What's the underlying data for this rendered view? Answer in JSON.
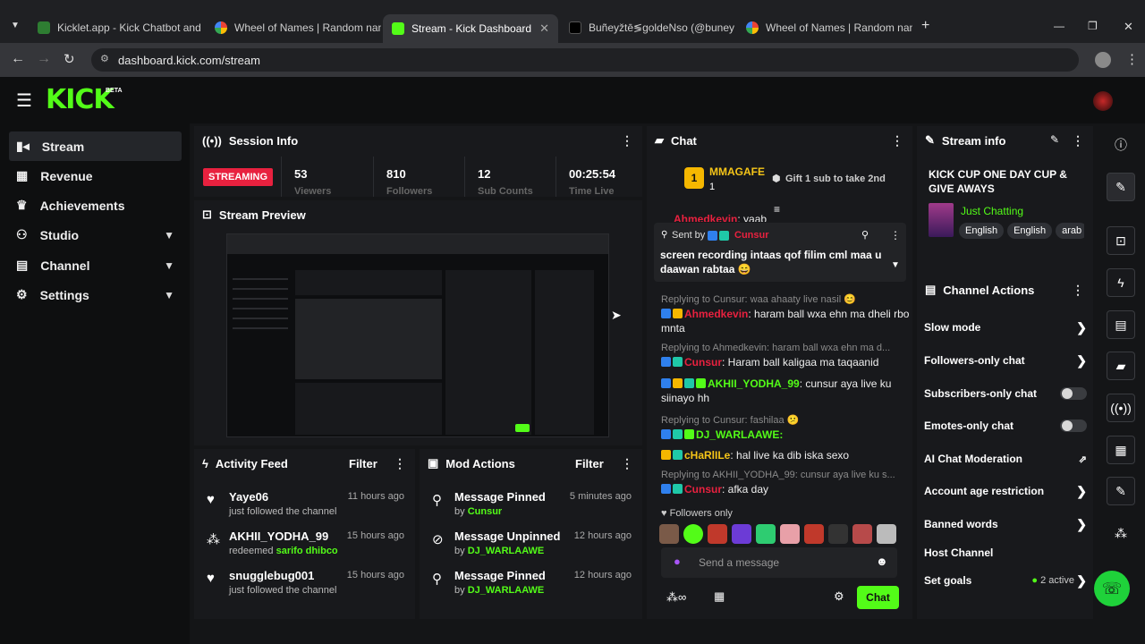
{
  "browser": {
    "tabs": [
      {
        "title": "Kicklet.app - Kick Chatbot and",
        "color": "#2e7d32"
      },
      {
        "title": "Wheel of Names | Random nan",
        "color": "#4285f4"
      },
      {
        "title": "Stream - Kick Dashboard",
        "color": "#53fc18"
      },
      {
        "title": "Buñeyžtē≶goldeNso (@buney",
        "color": "#000000"
      },
      {
        "title": "Wheel of Names | Random nan",
        "color": "#4285f4"
      }
    ],
    "url": "dashboard.kick.com/stream",
    "new_tab_icon": "+",
    "window_controls": [
      "—",
      "❐",
      "✕"
    ]
  },
  "app": {
    "logo": "KICK",
    "logo_badge": "BETA",
    "accent": "#53fc18"
  },
  "sidebar": {
    "items": [
      {
        "label": "Stream",
        "icon": "video-icon",
        "active": true
      },
      {
        "label": "Revenue",
        "icon": "chart-icon"
      },
      {
        "label": "Achievements",
        "icon": "trophy-icon"
      },
      {
        "label": "Studio",
        "icon": "studio-icon",
        "chevron": true
      },
      {
        "label": "Channel",
        "icon": "channel-icon",
        "chevron": true
      },
      {
        "label": "Settings",
        "icon": "gear-icon",
        "chevron": true
      }
    ]
  },
  "session": {
    "title": "Session Info",
    "status": "STREAMING",
    "stats": [
      {
        "value": "53",
        "label": "Viewers"
      },
      {
        "value": "810",
        "label": "Followers"
      },
      {
        "value": "12",
        "label": "Sub Counts"
      },
      {
        "value": "00:25:54",
        "label": "Time Live"
      }
    ]
  },
  "preview": {
    "title": "Stream Preview"
  },
  "activity": {
    "title": "Activity Feed",
    "filter": "Filter",
    "items": [
      {
        "name": "Yaye06",
        "sub": "just followed the channel",
        "time": "11 hours ago",
        "icon": "heart-icon"
      },
      {
        "name": "AKHII_YODHA_99",
        "sub_prefix": "redeemed ",
        "sub_highlight": "sarifo dhibco",
        "time": "15 hours ago",
        "icon": "points-icon"
      },
      {
        "name": "snugglebug001",
        "sub": "just followed the channel",
        "time": "15 hours ago",
        "icon": "heart-icon"
      }
    ]
  },
  "mod": {
    "title": "Mod Actions",
    "filter": "Filter",
    "items": [
      {
        "name": "Message Pinned",
        "by": "by ",
        "user": "Cunsur",
        "time": "5 minutes ago",
        "icon": "pin-icon"
      },
      {
        "name": "Message Unpinned",
        "by": "by ",
        "user": "DJ_WARLAAWE",
        "time": "12 hours ago",
        "icon": "unpin-icon"
      },
      {
        "name": "Message Pinned",
        "by": "by ",
        "user": "DJ_WARLAAWE",
        "time": "12 hours ago",
        "icon": "pin-icon"
      }
    ]
  },
  "chat": {
    "title": "Chat",
    "top_gifter": "MMAGAFE",
    "top_gifter_rank": "1",
    "top_gifter_count": "1",
    "gift_prompt": "Gift 1 sub to take 2nd",
    "pinned_by_label": "Sent by",
    "pinned_by": "Cunsur",
    "pinned_text": "screen recording intaas qof filim cml maa u daawan rabtaa 😄",
    "cut_user": "Ahmedkevin",
    "cut_text": ": yaab",
    "messages": [
      {
        "reply": "Replying to Cunsur: waa ahaaty live nasil 😊",
        "user": "Ahmedkevin",
        "user_class": "u-red",
        "text": ": haram ball wxa ehn ma dheli rbo mnta"
      },
      {
        "reply": "Replying to Ahmedkevin: haram ball wxa ehn ma d...",
        "user": "Cunsur",
        "user_class": "u-red",
        "text": ": Haram ball kaligaa ma taqaanid"
      },
      {
        "reply": "",
        "user": "AKHII_YODHA_99",
        "user_class": "u-green",
        "text": ": cunsur aya live ku siinayo hh"
      },
      {
        "reply": "Replying to Cunsur: fashilaa 😕",
        "user": "DJ_WARLAAWE:",
        "user_class": "u-green",
        "text": ""
      },
      {
        "reply": "",
        "user": "cHaRlILe",
        "user_class": "u-yel",
        "text": ": hal live ka dib iska sexo"
      },
      {
        "reply": "Replying to AKHII_YODHA_99: cunsur aya live ku s...",
        "user": "Cunsur",
        "user_class": "u-red",
        "text": ": afka day"
      }
    ],
    "followers_only": "Followers only",
    "input_placeholder": "Send a message",
    "send_label": "Chat"
  },
  "stream_info": {
    "title": "Stream info",
    "stream_title": "KICK CUP ONE DAY CUP & GIVE AWAYS",
    "category": "Just Chatting",
    "tags": [
      "English",
      "English",
      "arab"
    ]
  },
  "channel_actions": {
    "title": "Channel Actions",
    "rows": [
      {
        "label": "Slow mode",
        "kind": "arrow"
      },
      {
        "label": "Followers-only chat",
        "kind": "arrow"
      },
      {
        "label": "Subscribers-only chat",
        "kind": "toggle"
      },
      {
        "label": "Emotes-only chat",
        "kind": "toggle"
      },
      {
        "label": "AI Chat Moderation",
        "kind": "external"
      },
      {
        "label": "Account age restriction",
        "kind": "arrow"
      },
      {
        "label": "Banned words",
        "kind": "arrow"
      },
      {
        "label": "Host Channel",
        "kind": "none"
      },
      {
        "label": "Set goals",
        "kind": "arrow",
        "extra": "2 active"
      }
    ]
  }
}
